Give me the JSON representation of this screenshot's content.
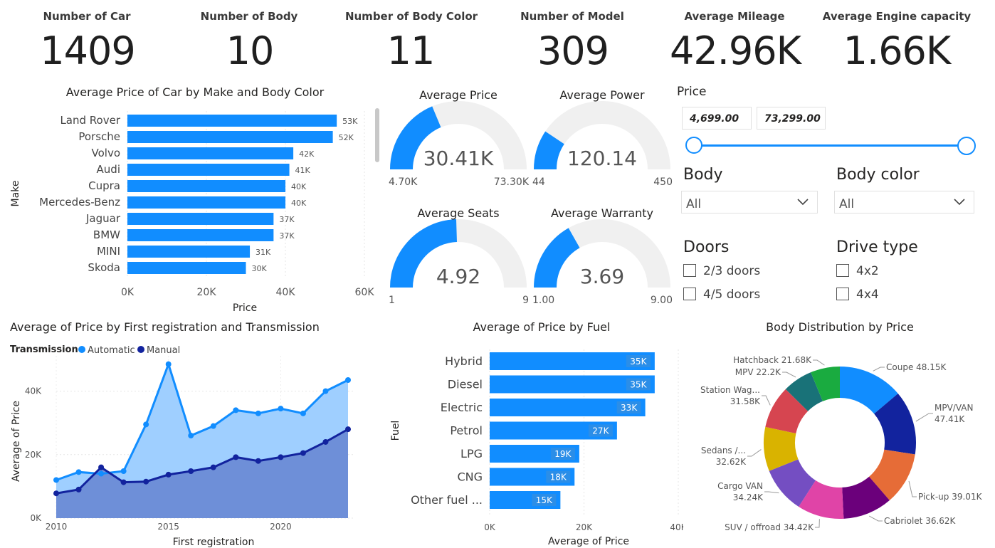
{
  "kpis": [
    {
      "label": "Number of Car",
      "value": "1409"
    },
    {
      "label": "Number of Body",
      "value": "10"
    },
    {
      "label": "Number of Body Color",
      "value": "11"
    },
    {
      "label": "Number of Model",
      "value": "309"
    },
    {
      "label": "Average Mileage",
      "value": "42.96K"
    },
    {
      "label": "Average Engine capacity",
      "value": "1.66K"
    }
  ],
  "colors": {
    "accent": "#118DFF",
    "dark": "#12239E",
    "area_light": "#9FCFFF",
    "area_dark": "#6B8BD6",
    "gauge_bg": "#F0F0F0"
  },
  "gauges": [
    {
      "title": "Average Price",
      "value": 30410,
      "min": 4700,
      "max": 73300,
      "value_label": "30.41K",
      "min_label": "4.70K",
      "max_label": "73.30K"
    },
    {
      "title": "Average Power",
      "value": 120.14,
      "min": 44,
      "max": 450,
      "value_label": "120.14",
      "min_label": "44",
      "max_label": "450"
    },
    {
      "title": "Average Seats",
      "value": 4.92,
      "min": 1,
      "max": 9,
      "value_label": "4.92",
      "min_label": "1",
      "max_label": "9"
    },
    {
      "title": "Average Warranty",
      "value": 3.69,
      "min": 1,
      "max": 9,
      "value_label": "3.69",
      "min_label": "1.00",
      "max_label": "9.00"
    }
  ],
  "slicers": {
    "price": {
      "title": "Price",
      "min_label": "4,699.00",
      "max_label": "73,299.00"
    },
    "body": {
      "title": "Body",
      "value": "All",
      "chevron": "chevron-down-icon"
    },
    "body_color": {
      "title": "Body color",
      "value": "All",
      "chevron": "chevron-down-icon"
    },
    "doors": {
      "title": "Doors",
      "options": [
        "2/3 doors",
        "4/5 doors"
      ]
    },
    "drive_type": {
      "title": "Drive type",
      "options": [
        "4x2",
        "4x4"
      ]
    }
  },
  "chart_data": [
    {
      "type": "bar",
      "orientation": "horizontal",
      "title": "Average Price of Car by Make and Body Color",
      "xlabel": "Price",
      "ylabel": "Make",
      "xlim": [
        0,
        60000
      ],
      "xticks": [
        "0K",
        "20K",
        "40K",
        "60K"
      ],
      "categories": [
        "Land Rover",
        "Porsche",
        "Volvo",
        "Audi",
        "Cupra",
        "Mercedes-Benz",
        "Jaguar",
        "BMW",
        "MINI",
        "Skoda"
      ],
      "values": [
        53000,
        52000,
        42000,
        41000,
        40000,
        40000,
        37000,
        37000,
        31000,
        30000
      ],
      "data_labels": [
        "53K",
        "52K",
        "42K",
        "41K",
        "40K",
        "40K",
        "37K",
        "37K",
        "31K",
        "30K"
      ]
    },
    {
      "type": "area",
      "title": "Average of Price by First registration and Transmission",
      "xlabel": "First registration",
      "ylabel": "Average of Price",
      "legend_title": "Transmission",
      "xlim": [
        2010,
        2023
      ],
      "ylim": [
        0,
        50000
      ],
      "xticks": [
        "2010",
        "2015",
        "2020"
      ],
      "yticks": [
        "0K",
        "20K",
        "40K"
      ],
      "x": [
        2010,
        2011,
        2012,
        2013,
        2014,
        2015,
        2016,
        2017,
        2018,
        2019,
        2020,
        2021,
        2022,
        2023
      ],
      "series": [
        {
          "name": "Automatic",
          "values": [
            12000,
            14500,
            14000,
            14800,
            29500,
            48500,
            26000,
            29000,
            34000,
            33000,
            34500,
            33000,
            40000,
            43500
          ]
        },
        {
          "name": "Manual",
          "values": [
            7800,
            9000,
            16000,
            11300,
            11500,
            13700,
            14800,
            16000,
            19200,
            18000,
            19200,
            20500,
            24000,
            28000
          ]
        }
      ]
    },
    {
      "type": "bar",
      "orientation": "horizontal",
      "title": "Average of Price by Fuel",
      "xlabel": "Average of Price",
      "ylabel": "Fuel",
      "xlim": [
        0,
        40000
      ],
      "xticks": [
        "0K",
        "20K",
        "40K"
      ],
      "categories": [
        "Hybrid",
        "Diesel",
        "Electric",
        "Petrol",
        "LPG",
        "CNG",
        "Other fuel ..."
      ],
      "values": [
        35000,
        35000,
        33000,
        27000,
        19000,
        18000,
        15000
      ],
      "data_labels": [
        "35K",
        "35K",
        "33K",
        "27K",
        "19K",
        "18K",
        "15K"
      ]
    },
    {
      "type": "pie",
      "donut": true,
      "title": "Body Distribution by Price",
      "categories": [
        "Coupe",
        "MPV/VAN",
        "Pick-up",
        "Cabriolet",
        "SUV / offroad",
        "Cargo VAN",
        "Sedans /...",
        "Station Wag...",
        "MPV",
        "Hatchback"
      ],
      "values": [
        48150,
        47410,
        39010,
        36620,
        34420,
        34240,
        32620,
        31580,
        22200,
        21680
      ],
      "labels": [
        "Coupe 48.15K",
        "MPV/VAN 47.41K",
        "Pick-up 39.01K",
        "Cabriolet 36.62K",
        "SUV / offroad 34.42K",
        "Cargo VAN 34.24K",
        "Sedans /... 32.62K",
        "Station Wag... 31.58K",
        "MPV 22.2K",
        "Hatchback 21.68K"
      ],
      "colors": [
        "#118DFF",
        "#12239E",
        "#E66C37",
        "#6B007B",
        "#E044A7",
        "#744EC2",
        "#D9B300",
        "#D64550",
        "#197278",
        "#1AAB40"
      ]
    }
  ]
}
